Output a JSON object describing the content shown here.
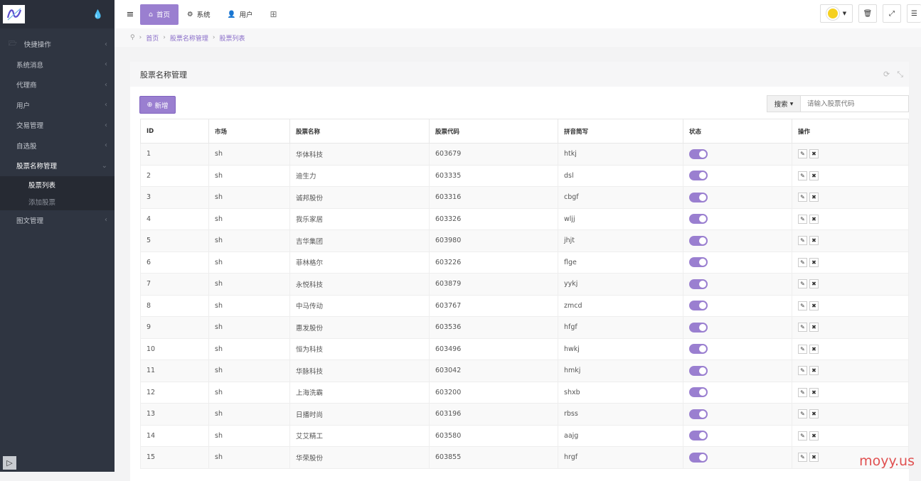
{
  "sidebar": {
    "items": [
      {
        "label": "快捷操作"
      },
      {
        "label": "系统消息"
      },
      {
        "label": "代理商"
      },
      {
        "label": "用户"
      },
      {
        "label": "交易管理"
      },
      {
        "label": "自选股"
      },
      {
        "label": "股票名称管理"
      },
      {
        "label": "图文管理"
      }
    ],
    "sub_items": [
      {
        "label": "股票列表"
      },
      {
        "label": "添加股票"
      }
    ]
  },
  "topbar": {
    "tabs": [
      {
        "label": "首页"
      },
      {
        "label": "系统"
      },
      {
        "label": "用户"
      }
    ]
  },
  "breadcrumb": {
    "items": [
      "首页",
      "股票名称管理",
      "股票列表"
    ]
  },
  "panel": {
    "title": "股票名称管理",
    "add_label": "新增",
    "search_label": "搜索",
    "search_placeholder": "请输入股票代码"
  },
  "table": {
    "headers": [
      "ID",
      "市场",
      "股票名称",
      "股票代码",
      "拼音简写",
      "状态",
      "操作"
    ],
    "rows": [
      {
        "id": "1",
        "market": "sh",
        "name": "华体科技",
        "code": "603679",
        "pinyin": "htkj",
        "status": true
      },
      {
        "id": "2",
        "market": "sh",
        "name": "迪生力",
        "code": "603335",
        "pinyin": "dsl",
        "status": true
      },
      {
        "id": "3",
        "market": "sh",
        "name": "诚邦股份",
        "code": "603316",
        "pinyin": "cbgf",
        "status": true
      },
      {
        "id": "4",
        "market": "sh",
        "name": "我乐家居",
        "code": "603326",
        "pinyin": "wljj",
        "status": true
      },
      {
        "id": "5",
        "market": "sh",
        "name": "吉华集团",
        "code": "603980",
        "pinyin": "jhjt",
        "status": true
      },
      {
        "id": "6",
        "market": "sh",
        "name": "菲林格尔",
        "code": "603226",
        "pinyin": "flge",
        "status": true
      },
      {
        "id": "7",
        "market": "sh",
        "name": "永悦科技",
        "code": "603879",
        "pinyin": "yykj",
        "status": true
      },
      {
        "id": "8",
        "market": "sh",
        "name": "中马传动",
        "code": "603767",
        "pinyin": "zmcd",
        "status": true
      },
      {
        "id": "9",
        "market": "sh",
        "name": "惠发股份",
        "code": "603536",
        "pinyin": "hfgf",
        "status": true
      },
      {
        "id": "10",
        "market": "sh",
        "name": "恒为科技",
        "code": "603496",
        "pinyin": "hwkj",
        "status": true
      },
      {
        "id": "11",
        "market": "sh",
        "name": "华脉科技",
        "code": "603042",
        "pinyin": "hmkj",
        "status": true
      },
      {
        "id": "12",
        "market": "sh",
        "name": "上海洗霸",
        "code": "603200",
        "pinyin": "shxb",
        "status": true
      },
      {
        "id": "13",
        "market": "sh",
        "name": "日播时尚",
        "code": "603196",
        "pinyin": "rbss",
        "status": true
      },
      {
        "id": "14",
        "market": "sh",
        "name": "艾艾精工",
        "code": "603580",
        "pinyin": "aajg",
        "status": true
      },
      {
        "id": "15",
        "market": "sh",
        "name": "华荣股份",
        "code": "603855",
        "pinyin": "hrgf",
        "status": true
      }
    ]
  },
  "watermark": "moyy.us"
}
